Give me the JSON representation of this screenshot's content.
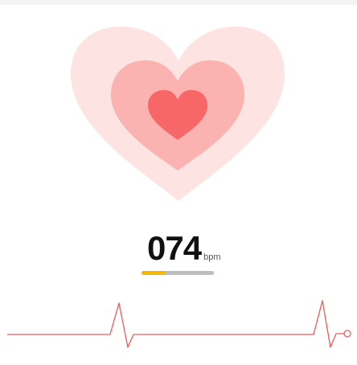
{
  "heart_rate": {
    "value": "074",
    "unit": "bpm",
    "progress_fraction": 0.33
  },
  "colors": {
    "outer_heart": "#fde3e1",
    "middle_heart": "#fbb3b1",
    "inner_heart": "#f86767",
    "ecg_line": "#ee5a5a",
    "progress_fill": "#f5b800",
    "progress_track": "#bdbdbd"
  },
  "icons": {
    "heart": "heart-icon",
    "ecg": "ecg-waveform-icon"
  }
}
